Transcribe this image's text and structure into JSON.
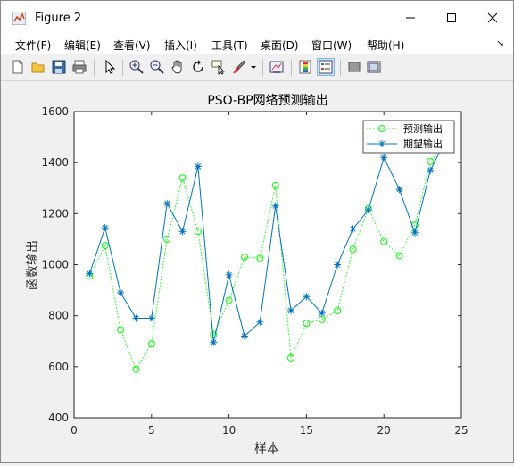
{
  "window": {
    "title": "Figure 2"
  },
  "menu": [
    "文件(F)",
    "编辑(E)",
    "查看(V)",
    "插入(I)",
    "工具(T)",
    "桌面(D)",
    "窗口(W)",
    "帮助(H)"
  ],
  "menu_overflow": "↘",
  "toolbar_icons": [
    "new-figure-icon",
    "open-file-icon",
    "save-icon",
    "print-icon",
    "pointer-icon",
    "zoom-in-icon",
    "zoom-out-icon",
    "pan-hand-icon",
    "rotate-icon",
    "data-cursor-icon",
    "brush-icon",
    "brush-dropdown-icon",
    "link-plot-icon",
    "colorbar-icon",
    "legend-icon",
    "hide-plot-tools-icon",
    "show-plot-tools-icon"
  ],
  "chart_data": {
    "type": "line",
    "title": "PSO-BP网络预测输出",
    "xlabel": "样本",
    "ylabel": "函数输出",
    "xlim": [
      0,
      25
    ],
    "ylim": [
      400,
      1600
    ],
    "xticks": [
      0,
      5,
      10,
      15,
      20,
      25
    ],
    "yticks": [
      400,
      600,
      800,
      1000,
      1200,
      1400,
      1600
    ],
    "legend_position": "top-right",
    "x": [
      1,
      2,
      3,
      4,
      5,
      6,
      7,
      8,
      9,
      10,
      11,
      12,
      13,
      14,
      15,
      16,
      17,
      18,
      19,
      20,
      21,
      22,
      23,
      24
    ],
    "series": [
      {
        "name": "预测输出",
        "color": "#00ff00",
        "style": "dotted",
        "marker": "circle",
        "values": [
          955,
          1075,
          745,
          590,
          690,
          1100,
          1340,
          1130,
          725,
          860,
          1030,
          1025,
          1310,
          635,
          770,
          785,
          820,
          1060,
          1220,
          1090,
          1035,
          1155,
          1405,
          1480
        ]
      },
      {
        "name": "期望输出",
        "color": "#0072bd",
        "style": "solid",
        "marker": "star",
        "values": [
          965,
          1145,
          890,
          790,
          790,
          1240,
          1130,
          1385,
          695,
          960,
          720,
          775,
          1230,
          820,
          875,
          810,
          1000,
          1140,
          1215,
          1420,
          1295,
          1125,
          1370,
          1490
        ]
      }
    ]
  }
}
